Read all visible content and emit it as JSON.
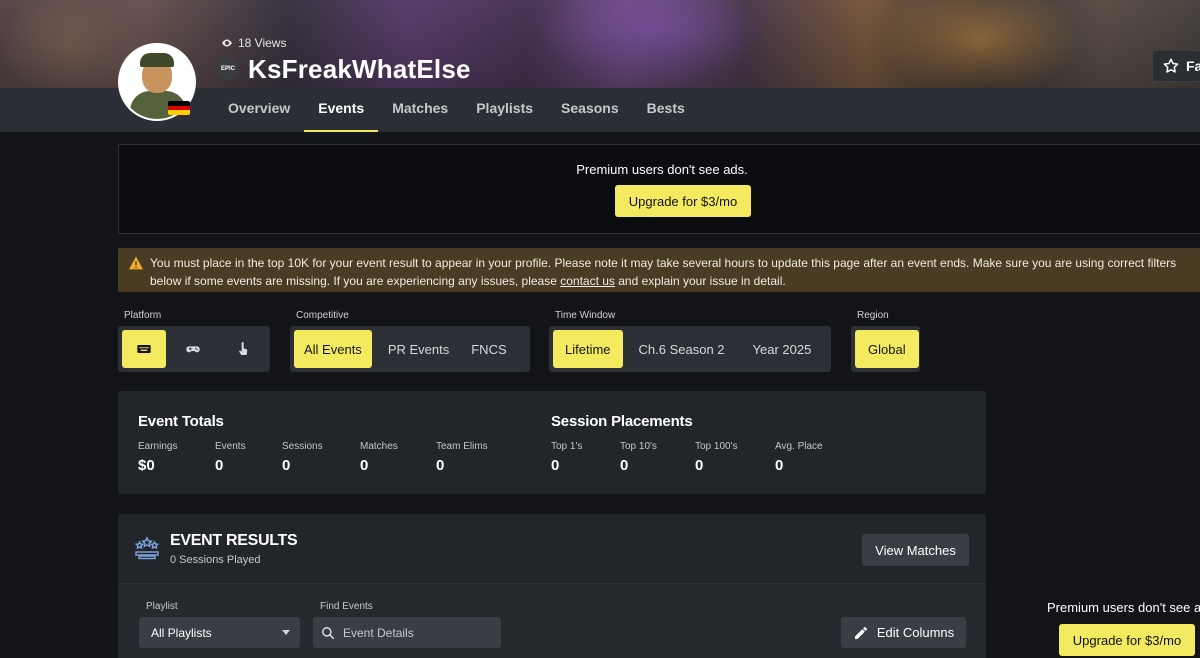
{
  "profile": {
    "views": "18 Views",
    "username": "KsFreakWhatElse",
    "platform_badge": "EPIC",
    "flag_colors": [
      "#000000",
      "#dd0000",
      "#ffce00"
    ],
    "favorite_label": "Fa"
  },
  "nav": {
    "tabs": [
      {
        "label": "Overview"
      },
      {
        "label": "Events"
      },
      {
        "label": "Matches"
      },
      {
        "label": "Playlists"
      },
      {
        "label": "Seasons"
      },
      {
        "label": "Bests"
      }
    ],
    "active": "Events"
  },
  "ad": {
    "text": "Premium users don't see ads.",
    "button": "Upgrade for $3/mo"
  },
  "warning": {
    "text_before": "You must place in the top 10K for your event result to appear in your profile. Please note it may take several hours to update this page after an event ends. Make sure you are using correct filters below if some events are missing. If you are experiencing any issues, please ",
    "link": "contact us",
    "text_after": " and explain your issue in detail."
  },
  "filters": {
    "platform": {
      "label": "Platform",
      "options": [
        "keyboard-icon",
        "gamepad-icon",
        "touch-icon"
      ],
      "selected": "keyboard-icon"
    },
    "competitive": {
      "label": "Competitive",
      "options": [
        "All Events",
        "PR Events",
        "FNCS"
      ],
      "selected": "All Events"
    },
    "time_window": {
      "label": "Time Window",
      "options": [
        "Lifetime",
        "Ch.6 Season 2",
        "Year 2025"
      ],
      "selected": "Lifetime"
    },
    "region": {
      "label": "Region",
      "options": [
        "Global"
      ],
      "selected": "Global"
    }
  },
  "event_totals": {
    "title": "Event Totals",
    "stats": [
      {
        "label": "Earnings",
        "value": "$0"
      },
      {
        "label": "Events",
        "value": "0"
      },
      {
        "label": "Sessions",
        "value": "0"
      },
      {
        "label": "Matches",
        "value": "0"
      },
      {
        "label": "Team Elims",
        "value": "0"
      }
    ]
  },
  "session_placements": {
    "title": "Session Placements",
    "stats": [
      {
        "label": "Top 1's",
        "value": "0"
      },
      {
        "label": "Top 10's",
        "value": "0"
      },
      {
        "label": "Top 100's",
        "value": "0"
      },
      {
        "label": "Avg. Place",
        "value": "0"
      }
    ]
  },
  "event_results": {
    "title": "EVENT RESULTS",
    "subtitle": "0 Sessions Played",
    "view_matches": "View Matches",
    "playlist_label": "Playlist",
    "playlist_value": "All Playlists",
    "find_label": "Find Events",
    "find_placeholder": "Event Details",
    "edit_columns": "Edit Columns"
  },
  "side_ad": {
    "text": "Premium users don't see ads.",
    "button": "Upgrade for $3/mo"
  },
  "colors": {
    "accent": "#f3ea5f",
    "background": "#121418",
    "panel": "#22252a",
    "warning_bg": "#4a3c22"
  }
}
